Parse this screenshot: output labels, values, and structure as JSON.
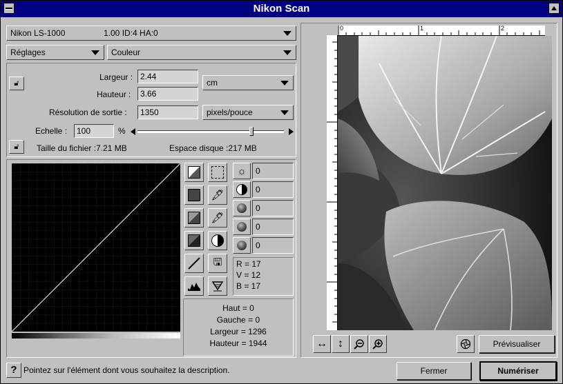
{
  "window": {
    "title": "Nikon Scan"
  },
  "scanner": {
    "device": "Nikon  LS-1000",
    "info": "1.00 ID:4 HA:0"
  },
  "settings": {
    "reglages": "Réglages",
    "mode": "Couleur"
  },
  "size": {
    "largeur_label": "Largeur :",
    "largeur": "2.44",
    "hauteur_label": "Hauteur :",
    "hauteur": "3.66",
    "unit": "cm",
    "resolution_label": "Résolution de sortie :",
    "resolution": "1350",
    "res_unit": "pixels/pouce",
    "echelle_label": "Echelle :",
    "echelle": "100",
    "percent": "%",
    "scale_level": 0.78,
    "filesize": "Taille du fichier :7.21 MB",
    "disk": "Espace disque :217 MB"
  },
  "color_values": [
    "0",
    "0",
    "0",
    "0",
    "0"
  ],
  "rgb": {
    "r": "R = 17",
    "v": "V = 12",
    "b": "B = 17"
  },
  "crop": {
    "haut": "Haut = 0",
    "gauche": "Gauche = 0",
    "largeur": "Largeur = 1296",
    "hauteur": "Hauteur = 1944"
  },
  "preview": {
    "ruler_ticks": [
      "0",
      "1",
      "2"
    ],
    "button": "Prévisualiser"
  },
  "status": {
    "help": "Pointez sur l'élément dont vous souhaitez la description."
  },
  "actions": {
    "close": "Fermer",
    "scan": "Numériser"
  },
  "colors": {
    "titlebar": "#000080",
    "face": "#c0c0c0"
  }
}
